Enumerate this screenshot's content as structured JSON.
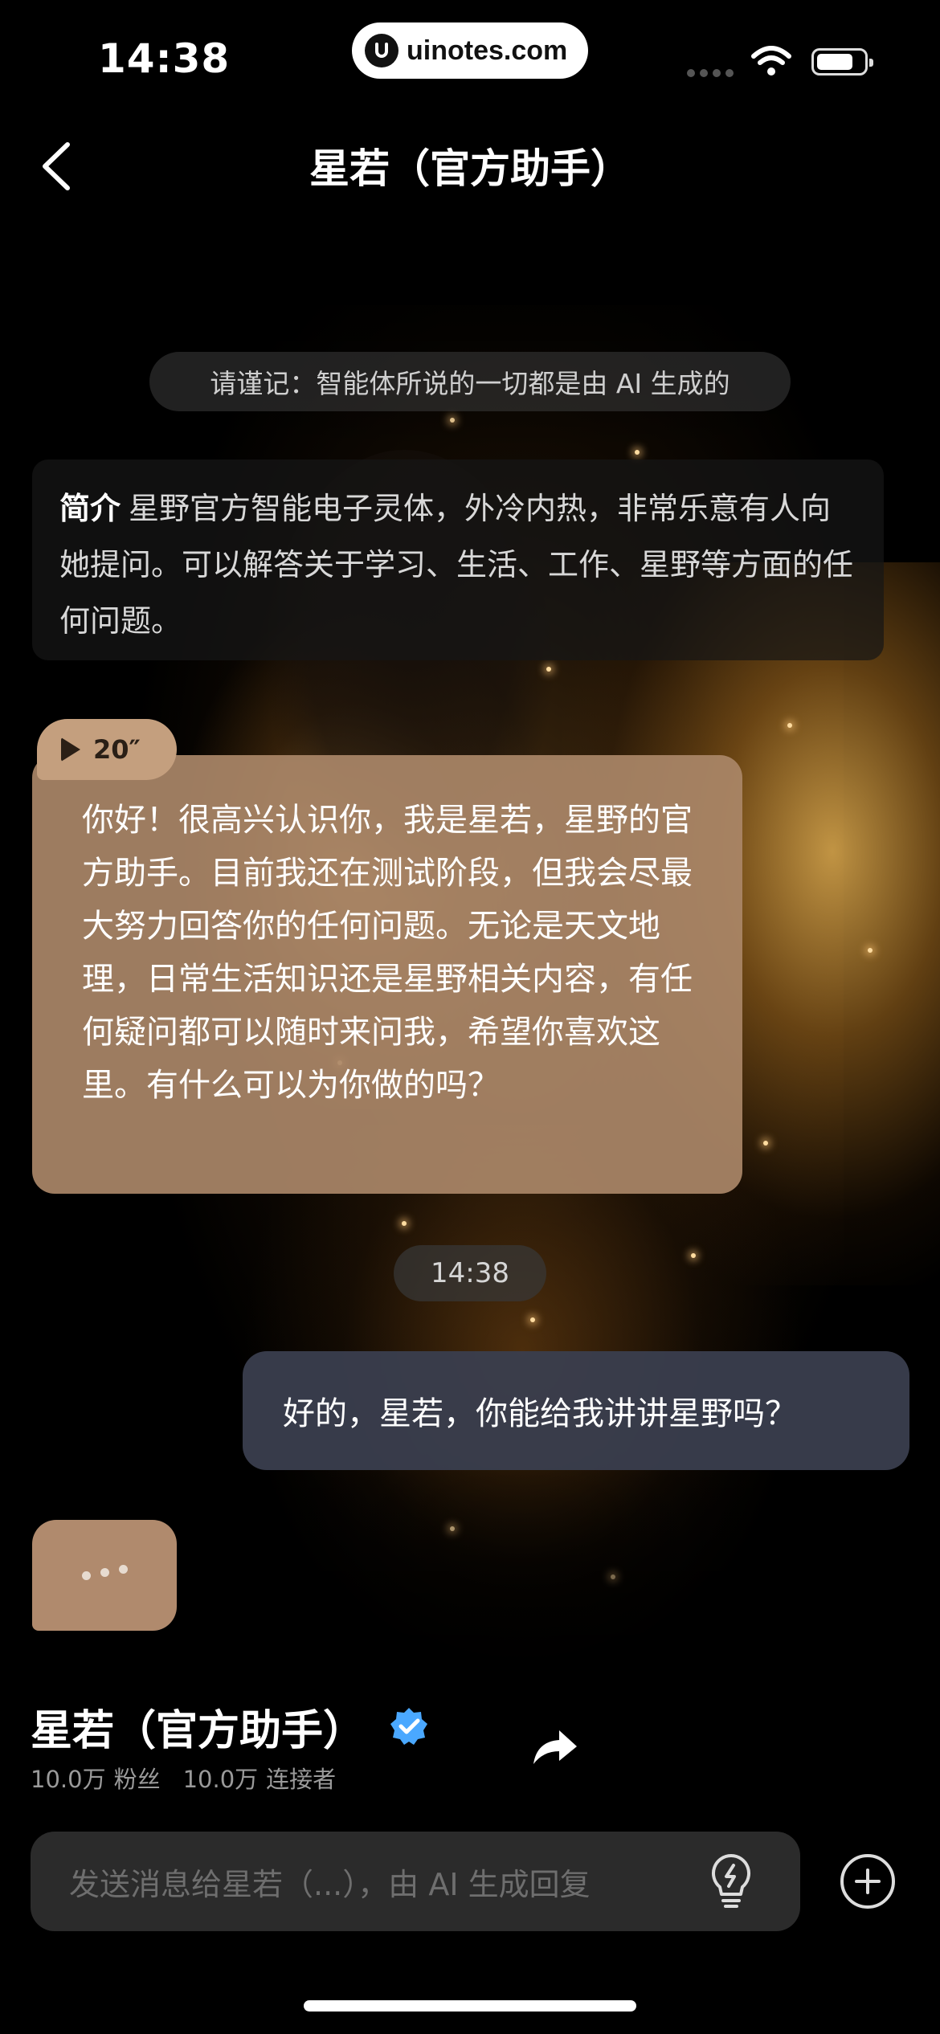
{
  "status_bar": {
    "time": "14:38",
    "url": "uinotes.com"
  },
  "nav": {
    "title": "星若（官方助手）"
  },
  "notice": "请谨记：智能体所说的一切都是由 AI 生成的",
  "intro": {
    "label": "简介",
    "text": "星野官方智能电子灵体，外冷内热，非常乐意有人向她提问。可以解答关于学习、生活、工作、星野等方面的任何问题。"
  },
  "messages": {
    "bot_audio_duration": "20″",
    "bot_text": "你好！很高兴认识你，我是星若，星野的官方助手。目前我还在测试阶段，但我会尽最大努力回答你的任何问题。无论是天文地理，日常生活知识还是星野相关内容，有任何疑问都可以随时来问我，希望你喜欢这里。有什么可以为你做的吗？",
    "timestamp": "14:38",
    "user_text": "好的，星若，你能给我讲讲星野吗？"
  },
  "profile": {
    "name": "星若（官方助手）",
    "followers_count": "10.0万",
    "followers_label": "粉丝",
    "connectors_count": "10.0万",
    "connectors_label": "连接者"
  },
  "input": {
    "placeholder": "发送消息给星若（...），由 AI 生成回复"
  },
  "colors": {
    "bot_bubble": "#aa8768",
    "user_bubble": "#3a3e4e",
    "verified": "#4aa8ff"
  }
}
